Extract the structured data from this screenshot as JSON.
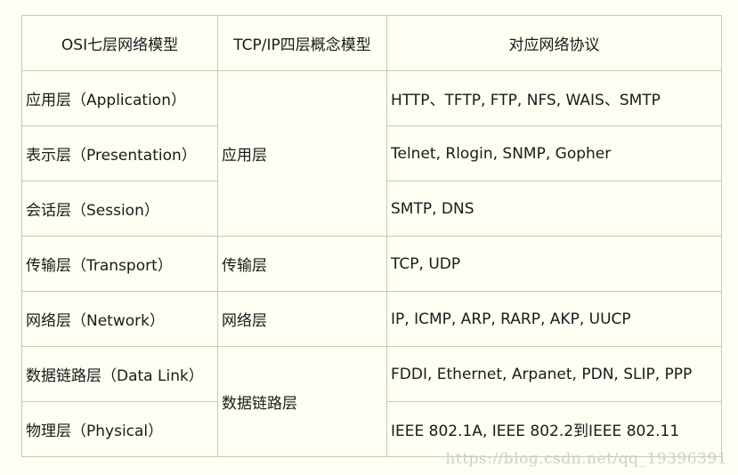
{
  "table": {
    "headers": [
      "OSI七层网络模型",
      "TCP/IP四层概念模型",
      "对应网络协议"
    ],
    "osi_layers": [
      "应用层（Application）",
      "表示层（Presentation）",
      "会话层（Session）",
      "传输层（Transport）",
      "网络层（Network）",
      "数据链路层（Data Link）",
      "物理层（Physical）"
    ],
    "tcpip_layers": [
      "应用层",
      "传输层",
      "网络层",
      "数据链路层"
    ],
    "protocols": [
      "HTTP、TFTP, FTP, NFS, WAIS、SMTP",
      "Telnet, Rlogin, SNMP, Gopher",
      "SMTP, DNS",
      "TCP, UDP",
      "IP, ICMP, ARP, RARP, AKP, UUCP",
      "FDDI, Ethernet, Arpanet, PDN, SLIP, PPP",
      "IEEE 802.1A, IEEE 802.2到IEEE 802.11"
    ]
  },
  "watermark": "https://blog.csdn.net/qq_19396391",
  "colors": {
    "background": "#fefef2",
    "border": "#c9c9b8",
    "text": "#1a1a1a",
    "watermark": "#cfcfc8"
  }
}
